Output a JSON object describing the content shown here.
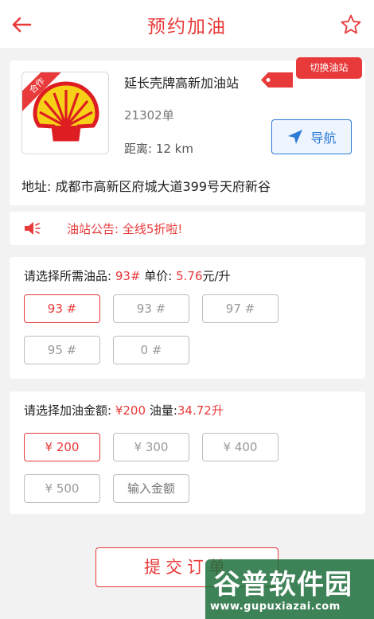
{
  "header": {
    "title": "预约加油"
  },
  "station": {
    "badge": "合作",
    "name": "延长壳牌高新加油站",
    "switch_label": "切换油站",
    "orders": "21302单",
    "distance": "距离: 12 km",
    "nav_label": "导航",
    "address": "地址: 成都市高新区府城大道399号天府新谷"
  },
  "notice": {
    "text": "油站公告: 全线5折啦!"
  },
  "oil": {
    "prefix": "请选择所需油品:",
    "selected": "93#",
    "price_label": "单价:",
    "price": "5.76",
    "unit": "元/升",
    "options": [
      "93 #",
      "93 #",
      "97 #",
      "95 #",
      "0 #"
    ]
  },
  "amount": {
    "prefix": "请选择加油金额:",
    "selected": "¥200",
    "volume_label": "油量:",
    "volume": "34.72升",
    "options": [
      "¥ 200",
      "¥ 300",
      "¥ 400",
      "¥ 500"
    ],
    "custom_placeholder": "输入金额"
  },
  "submit": {
    "label": "提交订单"
  },
  "watermark": {
    "cn": "谷普软件园",
    "url": "www.gupuxiazai.com"
  },
  "colors": {
    "accent": "#e83a3a",
    "nav_blue": "#2e7bd6",
    "shell_yellow": "#f7d117"
  }
}
